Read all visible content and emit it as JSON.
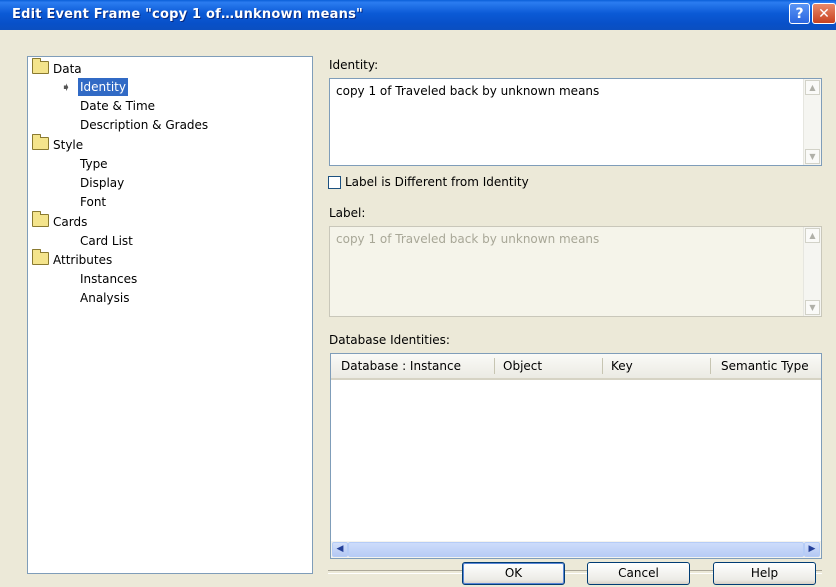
{
  "window": {
    "title": "Edit Event Frame \"copy 1 of…unknown means\"",
    "help_btn": "?",
    "close_btn": "✕"
  },
  "tree": {
    "groups": [
      {
        "label": "Data",
        "items": [
          "Identity",
          "Date & Time",
          "Description & Grades"
        ]
      },
      {
        "label": "Style",
        "items": [
          "Type",
          "Display",
          "Font"
        ]
      },
      {
        "label": "Cards",
        "items": [
          "Card List"
        ]
      },
      {
        "label": "Attributes",
        "items": [
          "Instances",
          "Analysis"
        ]
      }
    ],
    "selected": "Identity"
  },
  "identity": {
    "label": "Identity:",
    "value": "copy 1 of Traveled back by unknown means"
  },
  "checkbox": {
    "label": "Label is Different from Identity",
    "checked": false
  },
  "label_section": {
    "label": "Label:",
    "value": "copy 1 of Traveled back by unknown means"
  },
  "database": {
    "label": "Database Identities:",
    "columns": [
      "Database : Instance",
      "Object",
      "Key",
      "Semantic Type"
    ]
  },
  "buttons": {
    "ok": "OK",
    "cancel": "Cancel",
    "help": "Help"
  },
  "colors": {
    "titlebar": "#0b5ad6",
    "selection": "#316ac5",
    "dialog_bg": "#ece9d8"
  }
}
